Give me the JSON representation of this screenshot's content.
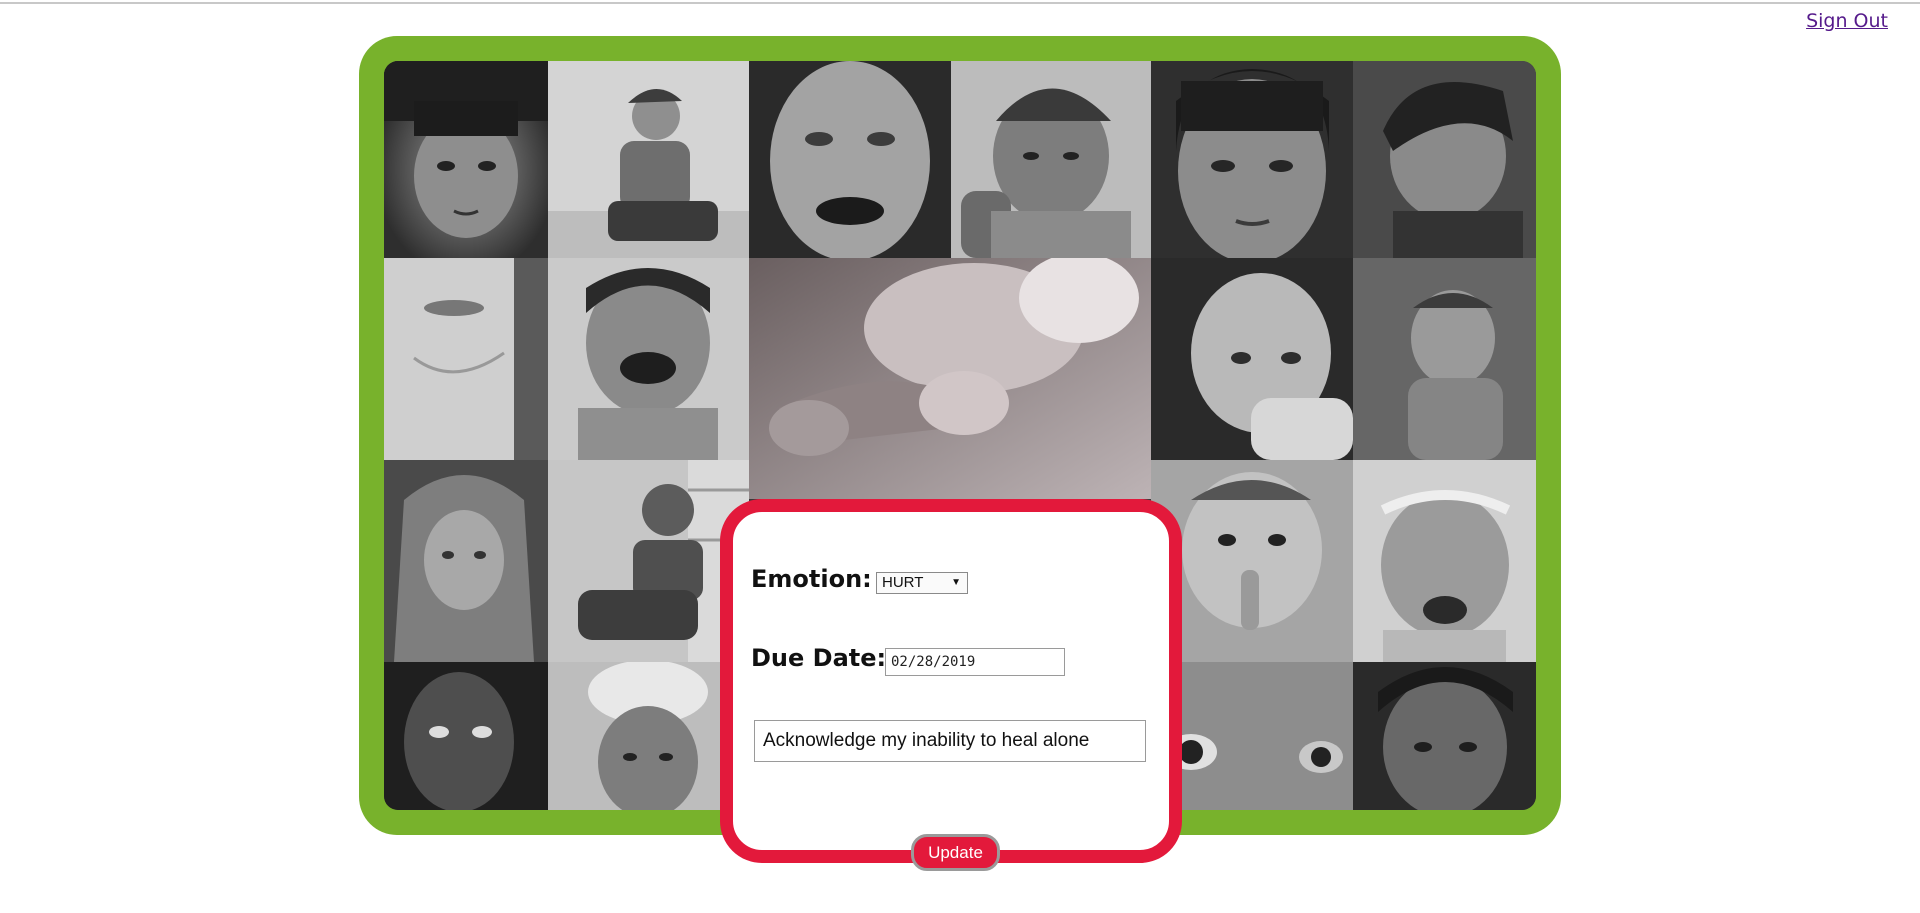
{
  "header": {
    "sign_out_label": "Sign Out"
  },
  "form": {
    "emotion_label": "Emotion:",
    "emotion_selected": "HURT",
    "due_date_label": "Due Date:",
    "due_date_value": "02/28/2019",
    "description_value": "Acknowledge my inability to heal alone",
    "update_label": "Update"
  },
  "colors": {
    "frame_green": "#78b22c",
    "panel_red": "#e3193b",
    "link_purple": "#551a8b"
  },
  "icons": {
    "select_arrow": "chevron-down-icon"
  }
}
